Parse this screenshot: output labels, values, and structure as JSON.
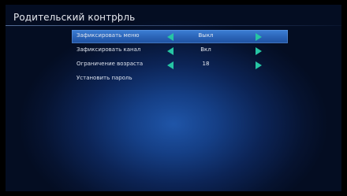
{
  "screen": {
    "title": "Родительский контроль"
  },
  "menu": {
    "items": [
      {
        "label": "Зафиксировать меню",
        "value": "Выкл"
      },
      {
        "label": "Зафиксировать канал",
        "value": "Вкл"
      },
      {
        "label": "Ограничение возраста",
        "value": "18"
      },
      {
        "label": "Установить пароль"
      }
    ],
    "selected_index": 0
  },
  "colors": {
    "accent_arrow": "#26c5a4",
    "selection": "#2a63b6",
    "background": "#0c2456"
  },
  "icons": {
    "prev": "arrow-left-icon",
    "next": "arrow-right-icon"
  }
}
